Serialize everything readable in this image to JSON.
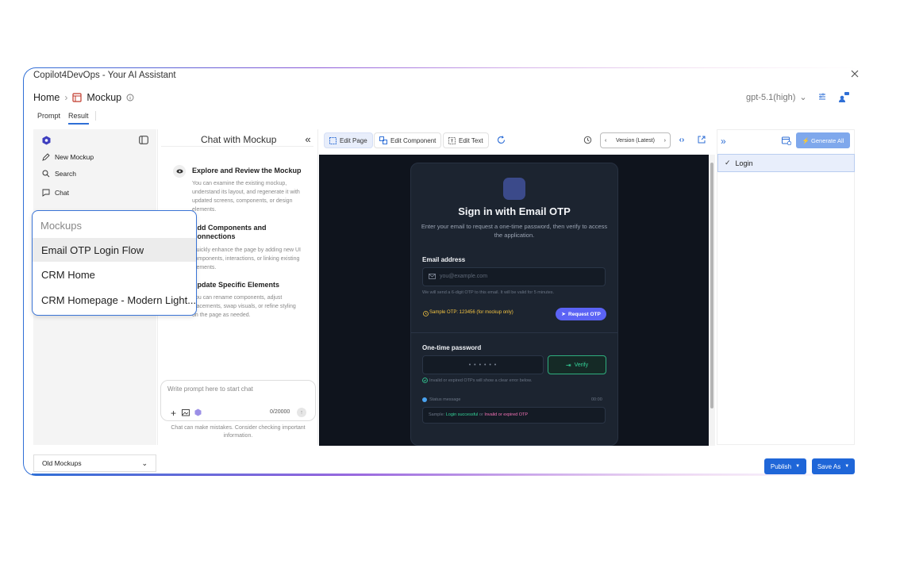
{
  "window": {
    "title": "Copilot4DevOps - Your AI Assistant"
  },
  "breadcrumb": {
    "home": "Home",
    "current": "Mockup"
  },
  "model": {
    "selected": "gpt-5.1(high)"
  },
  "tabs": [
    {
      "label": "Prompt"
    },
    {
      "label": "Result",
      "active": true
    }
  ],
  "sidebar": {
    "items": [
      {
        "label": "New Mockup",
        "icon": "edit-icon"
      },
      {
        "label": "Search",
        "icon": "search-icon"
      },
      {
        "label": "Chat",
        "icon": "chat-icon"
      }
    ],
    "old_mockups": "Old Mockups"
  },
  "mockups_popover": {
    "heading": "Mockups",
    "items": [
      "Email OTP Login Flow",
      "CRM Home",
      "CRM Homepage - Modern Light..."
    ]
  },
  "chat": {
    "title": "Chat with Mockup",
    "features": [
      {
        "title": "Explore and Review the Mockup",
        "desc": "You can examine the existing mockup, understand its layout, and regenerate it with updated screens, components, or design elements."
      },
      {
        "title": "Add Components and Connections",
        "desc": "Quickly enhance the page by adding new UI components, interactions, or linking existing elements."
      },
      {
        "title": "Update Specific Elements",
        "desc": "You can rename components, adjust placements, swap visuals, or refine styling on the page as needed."
      }
    ],
    "placeholder": "Write prompt here to start chat",
    "counter": "0/20000",
    "disclaimer": "Chat can make mistakes. Consider checking important information."
  },
  "toolbar": {
    "edit_page": "Edit Page",
    "edit_component": "Edit Component",
    "edit_text": "Edit Text",
    "version": "Version (Latest)"
  },
  "preview": {
    "heading": "Sign in with Email OTP",
    "subheading": "Enter your email to request a one-time password, then verify to access the application.",
    "email_label": "Email address",
    "email_placeholder": "you@example.com",
    "email_hint": "We will send a 6-digit OTP to this email. It will be valid for 5 minutes.",
    "sample_otp": "Sample OTP: 123456 (for mockup only)",
    "request_btn": "Request OTP",
    "otp_label": "One-time password",
    "otp_dots": "• • • • • •",
    "verify_btn": "Verify",
    "otp_hint": "Invalid or expired OTPs will show a clear error below.",
    "status_label": "Status message",
    "status_time": "00:00",
    "status_sample_prefix": "Sample:",
    "status_success": "Login successful",
    "status_or": "or",
    "status_error": "Invalid or expired OTP"
  },
  "right_panel": {
    "generate_all": "Generate All",
    "pages": [
      {
        "label": "Login",
        "checked": true
      }
    ]
  },
  "footer": {
    "publish": "Publish",
    "save_as": "Save As"
  },
  "colors": {
    "accent": "#1f66d8",
    "preview_bg": "#0f141d",
    "card_bg": "#1c2430",
    "request_btn": "#5b63f5",
    "verify_green": "#34d399",
    "warning": "#f5c542"
  }
}
